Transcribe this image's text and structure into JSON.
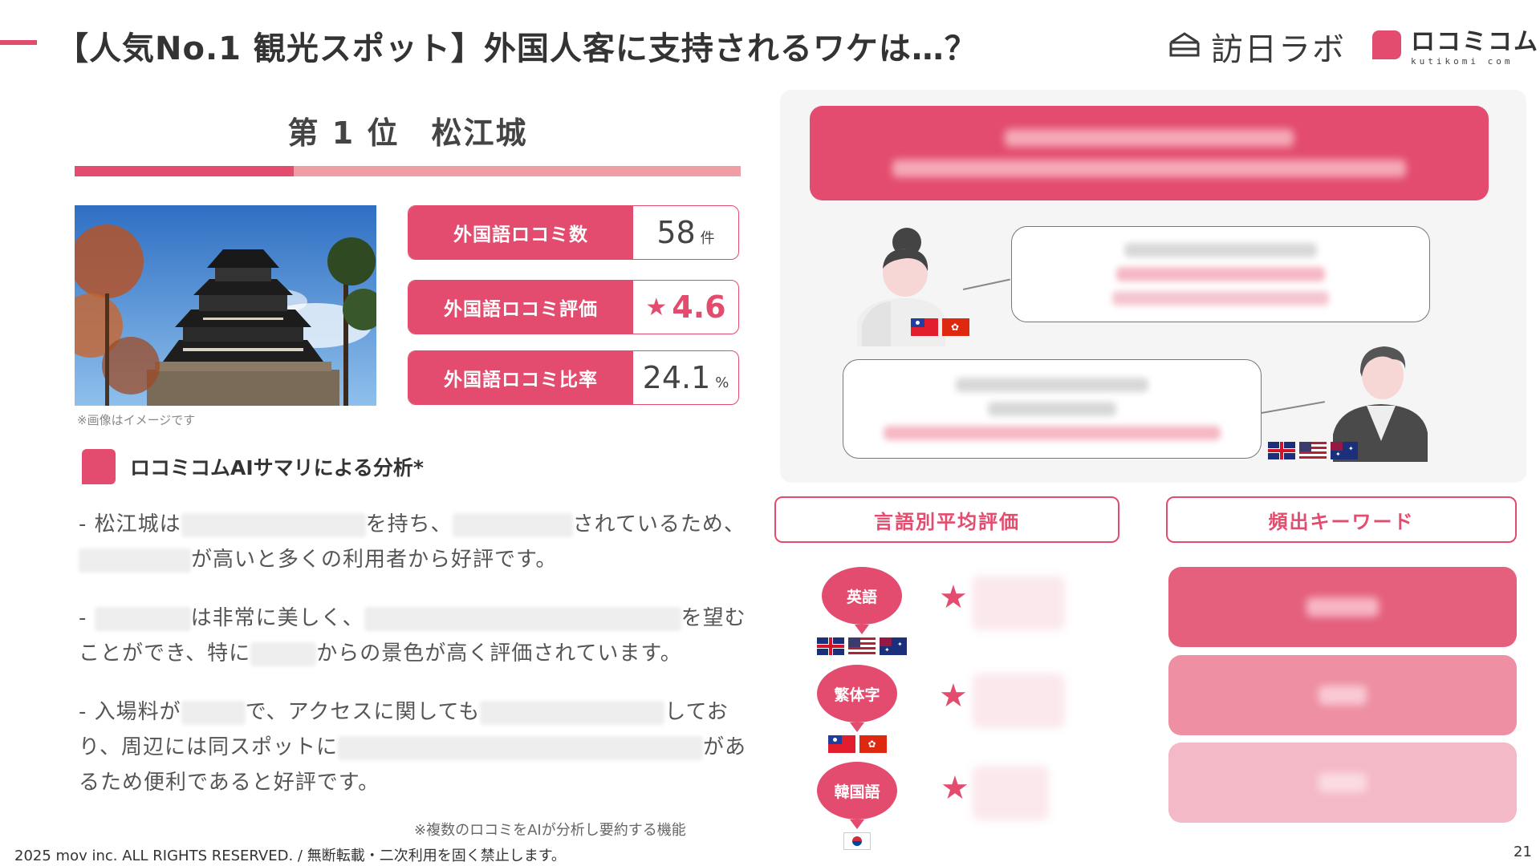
{
  "header": {
    "title": "【人気No.1 観光スポット】外国人客に支持されるワケは…？",
    "brand_primary": "訪日ラボ",
    "brand_secondary": "ロコミコム",
    "brand_secondary_sub": "kutikomi com"
  },
  "ranking": {
    "title": "第 1 位　松江城",
    "image_caption": "※画像はイメージです"
  },
  "stats": [
    {
      "label": "外国語ロコミ数",
      "value": "58",
      "unit": "件"
    },
    {
      "label": "外国語ロコミ評価",
      "icon": "star-icon",
      "value": "4.6"
    },
    {
      "label": "外国語ロコミ比率",
      "value": "24.1",
      "unit": "%"
    }
  ],
  "ai_summary": {
    "heading": "ロコミコムAIサマリによる分析*",
    "p1": {
      "a": "- 松江城は",
      "b": "を持ち、",
      "c": "されているため、",
      "d": "が高いと多くの利用者から好評です。"
    },
    "p2": {
      "a": "- ",
      "b": "は非常に美しく、",
      "c": "を望む",
      "d": "ことができ、特に",
      "e": "からの景色が高く評価されています。"
    },
    "p3": {
      "a": "- 入場料が",
      "b": "で、アクセスに関しても",
      "c": "してお",
      "d": "り、周辺には同スポットに",
      "e": "があ",
      "f": "るため便利であると好評です。"
    },
    "note": "※複数のロコミをAIが分析し要約する機能"
  },
  "sections": {
    "language_rating": "言語別平均評価",
    "keywords": "頻出キーワード"
  },
  "languages": [
    {
      "name": "英語",
      "flags": [
        "uk-flag-icon",
        "us-flag-icon",
        "australia-flag-icon"
      ]
    },
    {
      "name": "繁体字",
      "flags": [
        "taiwan-flag-icon",
        "hongkong-flag-icon"
      ]
    },
    {
      "name": "韓国語",
      "flags": [
        "korea-flag-icon"
      ]
    }
  ],
  "colors": {
    "accent": "#e34c6e",
    "accent_light": "#ee9ea4",
    "kw_1": "#e5607d",
    "kw_2": "#ee8fa3",
    "kw_3": "#f4b9c6"
  },
  "footer": {
    "copyright": "2025 mov inc. ALL RIGHTS RESERVED. / 無断転載・二次利用を固く禁止します。",
    "page_number": "21"
  }
}
